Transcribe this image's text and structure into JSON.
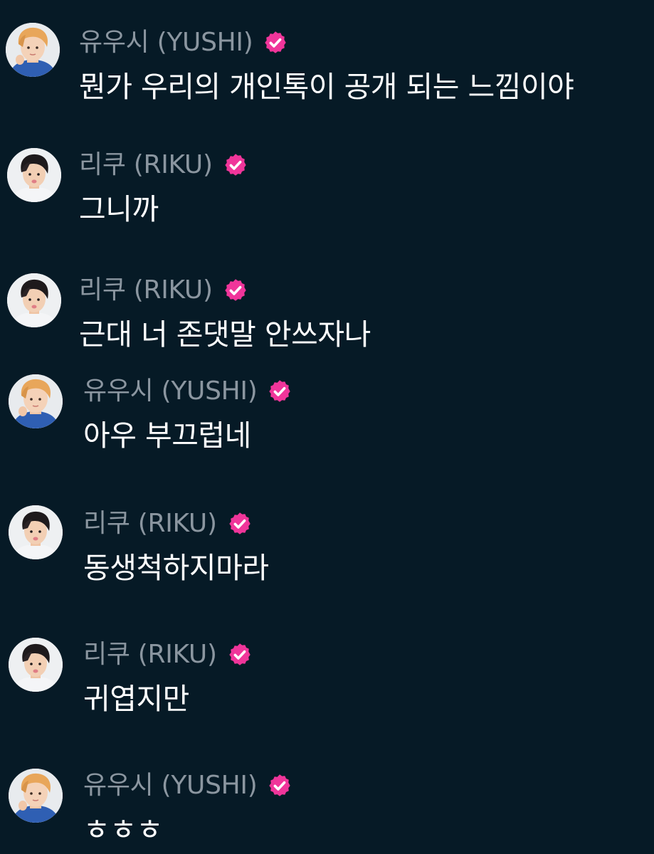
{
  "colors": {
    "background": "#061a26",
    "author_name": "#8b96a0",
    "message_text": "#ffffff",
    "verified_badge": "#f0359a"
  },
  "messages": [
    {
      "author": "유우시 (YUSHI)",
      "text": "뭔가 우리의 개인톡이 공개 되는 느낌이야",
      "avatar": "yushi-avatar",
      "verified": true
    },
    {
      "author": "리쿠 (RIKU)",
      "text": "그니까",
      "avatar": "riku-avatar",
      "verified": true
    },
    {
      "author": "리쿠 (RIKU)",
      "text": "근대 너 존댓말 안쓰자나",
      "avatar": "riku-avatar",
      "verified": true
    },
    {
      "author": "유우시 (YUSHI)",
      "text": "아우 부끄럽네",
      "avatar": "yushi-avatar",
      "verified": true
    },
    {
      "author": "리쿠 (RIKU)",
      "text": "동생척하지마라",
      "avatar": "riku-avatar",
      "verified": true
    },
    {
      "author": "리쿠 (RIKU)",
      "text": "귀엽지만",
      "avatar": "riku-avatar",
      "verified": true
    },
    {
      "author": "유우시 (YUSHI)",
      "text": "ㅎㅎㅎ",
      "avatar": "yushi-avatar",
      "verified": true
    }
  ]
}
